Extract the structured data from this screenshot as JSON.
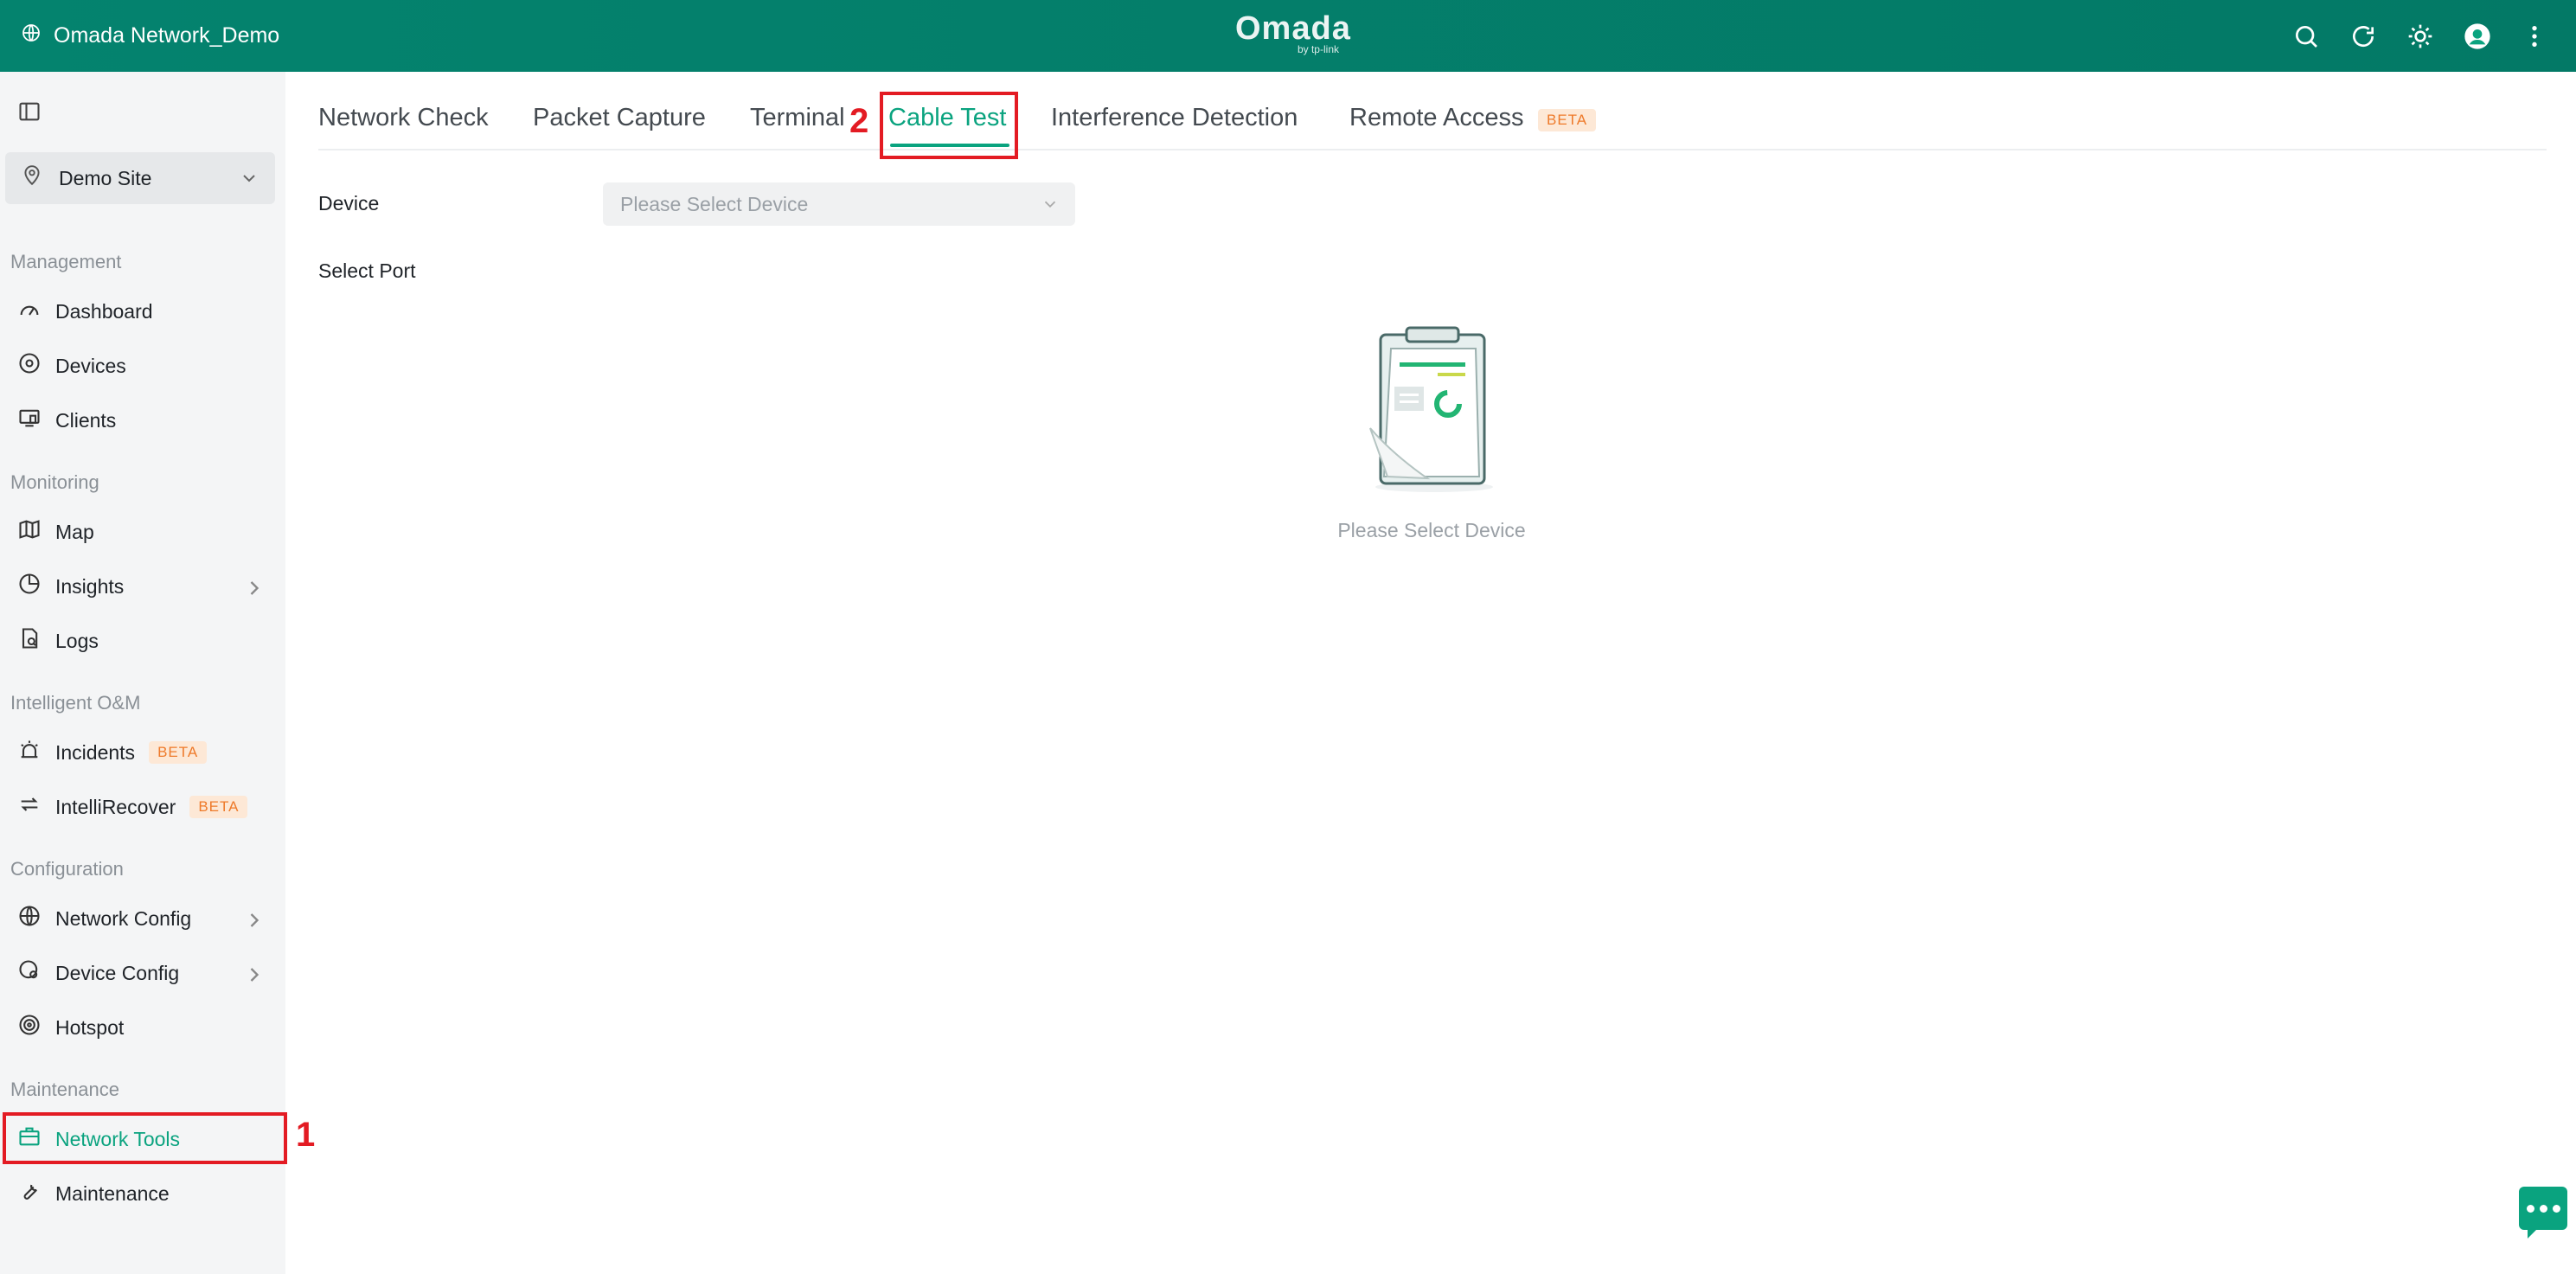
{
  "header": {
    "site_name": "Omada Network_Demo",
    "brand": "Omada",
    "brand_sub": "by tp-link",
    "actions": [
      "search-icon",
      "refresh-icon",
      "theme-icon",
      "avatar",
      "more-icon"
    ]
  },
  "sidebar": {
    "site_selector": "Demo Site",
    "sections": {
      "management": "Management",
      "monitoring": "Monitoring",
      "intelligent": "Intelligent O&M",
      "configuration": "Configuration",
      "maintenance": "Maintenance"
    },
    "items": {
      "dashboard": "Dashboard",
      "devices": "Devices",
      "clients": "Clients",
      "map": "Map",
      "insights": "Insights",
      "logs": "Logs",
      "incidents": "Incidents",
      "intellirecover": "IntelliRecover",
      "network_config": "Network Config",
      "device_config": "Device Config",
      "hotspot": "Hotspot",
      "network_tools": "Network Tools",
      "maintenance": "Maintenance"
    },
    "beta": "BETA"
  },
  "tabs": {
    "network_check": "Network Check",
    "packet_capture": "Packet Capture",
    "terminal": "Terminal",
    "cable_test": "Cable Test",
    "interference": "Interference Detection",
    "remote_access": "Remote Access",
    "beta": "BETA"
  },
  "form": {
    "device_label": "Device",
    "device_placeholder": "Please Select Device",
    "port_label": "Select Port"
  },
  "empty_state": "Please Select Device",
  "annotations": {
    "marker1": "1",
    "marker2": "2"
  },
  "colors": {
    "header": "#04836e",
    "accent": "#0aa37f",
    "highlight": "#e31b23",
    "beta": "#ee7a2a"
  }
}
